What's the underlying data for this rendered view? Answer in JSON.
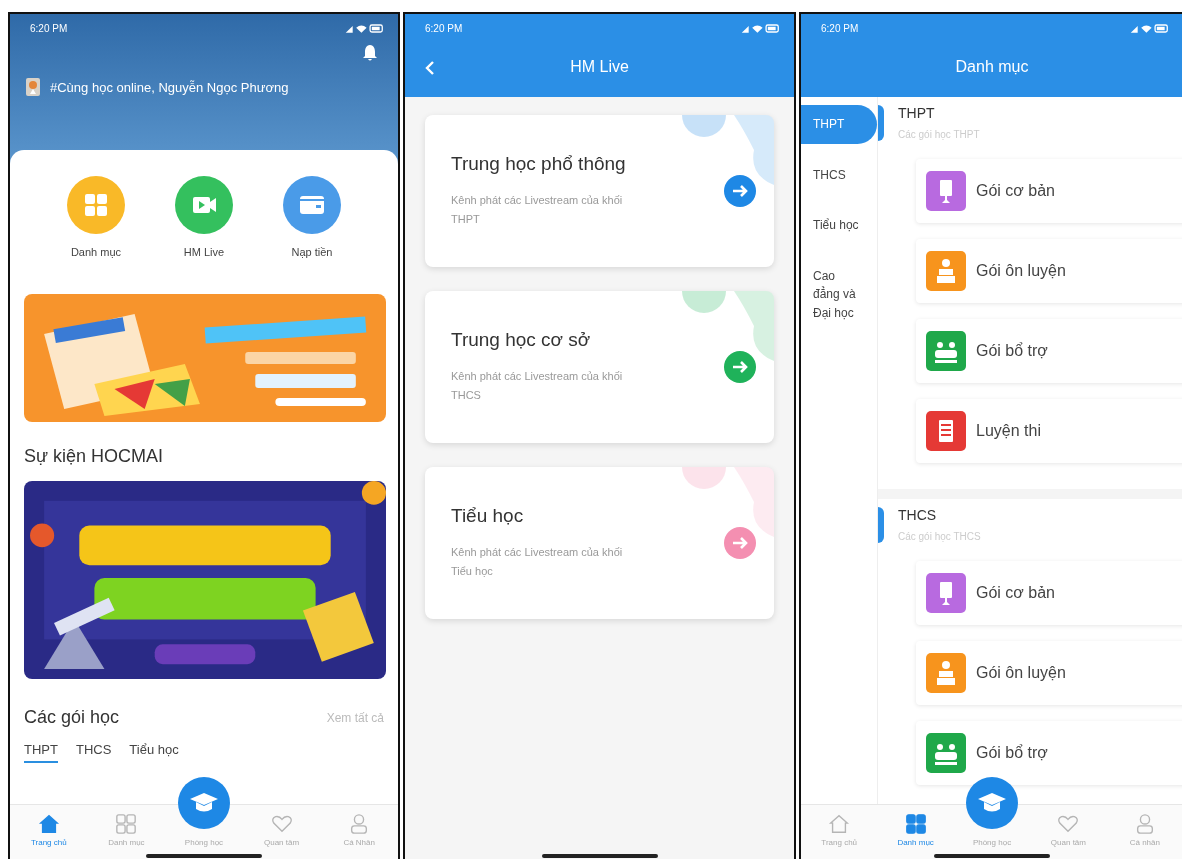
{
  "home": {
    "status_time": "6:20 PM",
    "greeting": "#Cùng học online,  Nguyễn Ngọc Phương",
    "quick_actions": [
      {
        "label": "Danh mục",
        "color": "#f9b928",
        "kind": "grid"
      },
      {
        "label": "HM Live",
        "color": "#34c05e",
        "kind": "video"
      },
      {
        "label": "Nạp tiền",
        "color": "#4a9be8",
        "kind": "wallet"
      }
    ],
    "events_title": "Sự kiện HOCMAI",
    "packages_title": "Các gói học",
    "see_all": "Xem tất cả",
    "tabs": [
      {
        "label": "THPT",
        "selected": true
      },
      {
        "label": "THCS",
        "selected": false
      },
      {
        "label": "Tiểu học",
        "selected": false
      }
    ],
    "nav": [
      {
        "label": "Trang chủ",
        "kind": "home",
        "selected": true
      },
      {
        "label": "Danh mục",
        "kind": "grid",
        "selected": false
      },
      {
        "label": "Phòng học",
        "kind": "cap",
        "selected": false
      },
      {
        "label": "Quan tâm",
        "kind": "heart",
        "selected": false
      },
      {
        "label": "Cá Nhân",
        "kind": "person",
        "selected": false
      }
    ]
  },
  "hm_live": {
    "status_time": "6:20 PM",
    "title": "HM Live",
    "cards": [
      {
        "title": "Trung học phổ thông",
        "subtitle": "Kênh phát các Livestream của khối THPT",
        "color": "#1e88e5"
      },
      {
        "title": "Trung học cơ sở",
        "subtitle": "Kênh phát các Livestream của khối THCS",
        "color": "#1fb25a"
      },
      {
        "title": "Tiểu học",
        "subtitle": "Kênh phát các Livestream của khối Tiểu học",
        "color": "#f48fb1"
      }
    ]
  },
  "categories": {
    "status_time": "6:20 PM",
    "title": "Danh mục",
    "sidebar": [
      {
        "label": "THPT",
        "selected": true
      },
      {
        "label": "THCS",
        "selected": false
      },
      {
        "label": "Tiểu học",
        "selected": false
      },
      {
        "label": "Cao đẳng và Đại học",
        "selected": false
      }
    ],
    "sections": [
      {
        "title": "THPT",
        "subtitle": "Các gói học THPT",
        "items": [
          {
            "label": "Gói cơ bản",
            "color": "#b86ae0",
            "kind": "basic"
          },
          {
            "label": "Gói ôn luyện",
            "color": "#f7941d",
            "kind": "review"
          },
          {
            "label": "Gói bổ trợ",
            "color": "#1fa84a",
            "kind": "support"
          },
          {
            "label": "Luyện thi",
            "color": "#e53935",
            "kind": "exam"
          }
        ]
      },
      {
        "title": "THCS",
        "subtitle": "Các gói học THCS",
        "items": [
          {
            "label": "Gói cơ bản",
            "color": "#b86ae0",
            "kind": "basic"
          },
          {
            "label": "Gói ôn luyện",
            "color": "#f7941d",
            "kind": "review"
          },
          {
            "label": "Gói bổ trợ",
            "color": "#1fa84a",
            "kind": "support"
          }
        ]
      }
    ],
    "nav": [
      {
        "label": "Trang chủ",
        "kind": "home",
        "selected": false
      },
      {
        "label": "Danh mục",
        "kind": "grid",
        "selected": true
      },
      {
        "label": "Phòng học",
        "kind": "cap",
        "selected": false
      },
      {
        "label": "Quan tâm",
        "kind": "heart",
        "selected": false
      },
      {
        "label": "Cá nhân",
        "kind": "person",
        "selected": false
      }
    ]
  }
}
